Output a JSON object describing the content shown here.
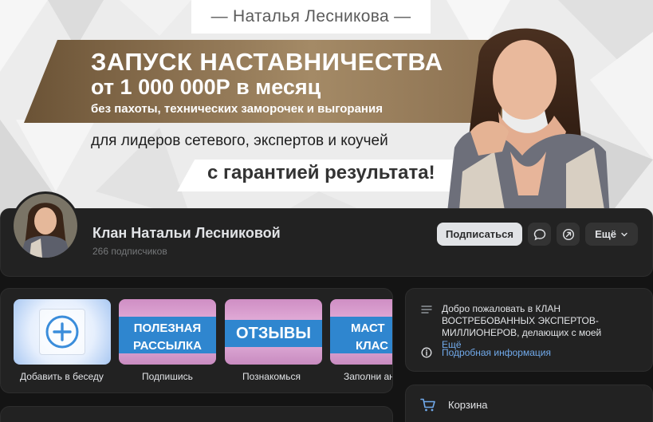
{
  "cover": {
    "name_banner": "— Наталья Лесникова —",
    "title_line1": "ЗАПУСК НАСТАВНИЧЕСТВА",
    "title_line2": "от 1 000 000Р в месяц",
    "title_line3": "без пахоты, технических заморочек и выгорания",
    "subtitle": "для лидеров сетевого, экспертов и коучей",
    "guarantee": "с гарантией результата!"
  },
  "profile": {
    "name": "Клан Натальи Лесниковой",
    "subscribers": "266 подписчиков",
    "subscribe_label": "Подписаться",
    "more_label": "Ещё"
  },
  "widgets": {
    "tiles": [
      {
        "image_text": [],
        "label": "Добавить в беседу"
      },
      {
        "image_text": [
          "ПОЛЕЗНАЯ",
          "РАССЫЛКА"
        ],
        "label": "Подпишись"
      },
      {
        "image_text": [
          "ОТЗЫВЫ"
        ],
        "label": "Познакомься"
      },
      {
        "image_text": [
          "МАСТ",
          "КЛАС"
        ],
        "label": "Заполни ан"
      }
    ]
  },
  "info": {
    "description": "Добро пожаловать в КЛАН ВОСТРЕБОВАННЫХ ЭКСПЕРТОВ-МИЛЛИОНЕРОВ, делающих с моей",
    "more": "Ещё",
    "details_link": "Подробная информация"
  },
  "cart": {
    "label": "Корзина"
  },
  "colors": {
    "page_bg": "#141414",
    "card_bg": "#222222",
    "link": "#71aaeb",
    "gold": "#8d7352",
    "tile_blue": "#2f86cf",
    "tile_pink": "#e9b9e0"
  }
}
